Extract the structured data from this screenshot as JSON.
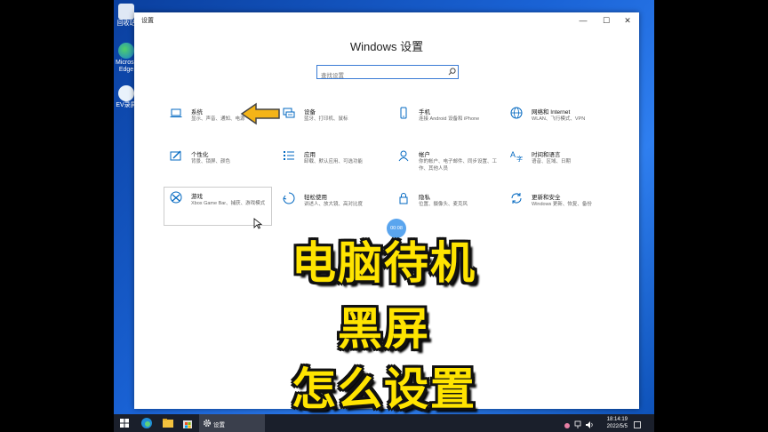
{
  "desktop": {
    "icons": [
      {
        "label": "回收站"
      },
      {
        "label": "Microsoft Edge"
      },
      {
        "label": "EV录屏"
      }
    ]
  },
  "window": {
    "title": "设置",
    "controls": {
      "minimize": "—",
      "maximize": "☐",
      "close": "✕"
    },
    "heading": "Windows 设置",
    "search_placeholder": "查找设置"
  },
  "tiles": [
    {
      "name": "系统",
      "desc": "显示、声音、通知、电源",
      "icon": "laptop-icon"
    },
    {
      "name": "设备",
      "desc": "蓝牙、打印机、鼠标",
      "icon": "keyboard-icon"
    },
    {
      "name": "手机",
      "desc": "连接 Android 设备和 iPhone",
      "icon": "phone-icon"
    },
    {
      "name": "网络和 Internet",
      "desc": "WLAN、飞行模式、VPN",
      "icon": "globe-icon"
    },
    {
      "name": "个性化",
      "desc": "背景、锁屏、颜色",
      "icon": "paintbrush-icon"
    },
    {
      "name": "应用",
      "desc": "卸载、默认应用、可选功能",
      "icon": "apps-list-icon"
    },
    {
      "name": "帐户",
      "desc": "你的帐户、电子邮件、同步设置、工作、其他人员",
      "icon": "person-icon"
    },
    {
      "name": "时间和语言",
      "desc": "语音、区域、日期",
      "icon": "language-icon"
    },
    {
      "name": "游戏",
      "desc": "Xbox Game Bar、捕获、游戏模式",
      "icon": "xbox-icon"
    },
    {
      "name": "轻松使用",
      "desc": "讲述人、放大镜、高对比度",
      "icon": "ease-of-access-icon"
    },
    {
      "name": "隐私",
      "desc": "位置、摄像头、麦克风",
      "icon": "lock-icon"
    },
    {
      "name": "更新和安全",
      "desc": "Windows 更新、恢复、备份",
      "icon": "sync-icon"
    }
  ],
  "recording_timer": "00:08",
  "overlay_lines": [
    "电脑待机",
    "黑屏",
    "怎么设置"
  ],
  "taskbar": {
    "settings_label": "设置",
    "time": "18:14:19",
    "date": "2022/5/5"
  },
  "colors": {
    "accent": "#0067c0",
    "overlay_text": "#ffe400"
  }
}
